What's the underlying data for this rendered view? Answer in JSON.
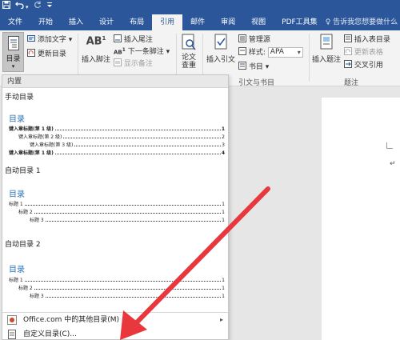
{
  "titlebar": {
    "save_icon": "save-icon",
    "undo_icon": "undo-icon",
    "undo_caret": "▾",
    "redo_icon": "redo-icon",
    "customize_icon": "customize-quick-access-icon"
  },
  "tabs": [
    {
      "label": "文件",
      "active": false
    },
    {
      "label": "开始",
      "active": false
    },
    {
      "label": "插入",
      "active": false
    },
    {
      "label": "设计",
      "active": false
    },
    {
      "label": "布局",
      "active": false
    },
    {
      "label": "引用",
      "active": true
    },
    {
      "label": "邮件",
      "active": false
    },
    {
      "label": "审阅",
      "active": false
    },
    {
      "label": "视图",
      "active": false
    },
    {
      "label": "PDF工具集",
      "active": false
    }
  ],
  "tell_me": "♀ 告诉我您想要做什么",
  "ribbon": {
    "toc_button": "目录",
    "add_text": "添加文字 ▾",
    "update_toc": "更新目录",
    "insert_footnote": "插入脚注",
    "ab_label": "AB",
    "ab_sup": "1",
    "insert_endnote": "插入尾注",
    "next_footnote": "下一条脚注 ▾",
    "show_notes": "显示备注",
    "smart_lookup": "论文\n查重",
    "insert_citation": "插入引文",
    "manage_sources": "管理源",
    "style_label": "样式:",
    "style_value": "APA",
    "bibliography": "书目 ▾",
    "citations_group": "引文与书目",
    "insert_caption": "插入题注",
    "insert_table_of_figures": "插入表目录",
    "update_table": "更新表格",
    "cross_reference": "交叉引用",
    "captions_group": "题注"
  },
  "dropdown": {
    "header": "内置",
    "manual": {
      "title": "手动目录",
      "heading": "目录",
      "rows": [
        {
          "label": "键入章标题(第 1 级)",
          "page": "1",
          "level": 1
        },
        {
          "label": "键入章标题(第 2 级)",
          "page": "2",
          "level": 2
        },
        {
          "label": "键入章标题(第 3 级)",
          "page": "3",
          "level": 3
        },
        {
          "label": "键入章标题(第 1 级)",
          "page": "4",
          "level": 1
        }
      ]
    },
    "auto1": {
      "title": "自动目录 1",
      "heading": "目录",
      "rows": [
        {
          "label": "标题 1",
          "page": "1",
          "level": 1
        },
        {
          "label": "标题 2",
          "page": "1",
          "level": 2
        },
        {
          "label": "标题 3",
          "page": "1",
          "level": 3
        }
      ]
    },
    "auto2": {
      "title": "自动目录 2",
      "heading": "目录",
      "rows": [
        {
          "label": "标题 1",
          "page": "1",
          "level": 1
        },
        {
          "label": "标题 2",
          "page": "1",
          "level": 2
        },
        {
          "label": "标题 3",
          "page": "1",
          "level": 3
        }
      ]
    },
    "menu": [
      {
        "label": "Office.com 中的其他目录(M)",
        "icon": "office-icon",
        "submenu": true
      },
      {
        "label": "自定义目录(C)...",
        "icon": "custom-toc-icon",
        "submenu": false
      }
    ]
  },
  "colors": {
    "accent": "#2b579a",
    "toc_heading": "#2e74b5",
    "arrow": "#e8383d"
  }
}
